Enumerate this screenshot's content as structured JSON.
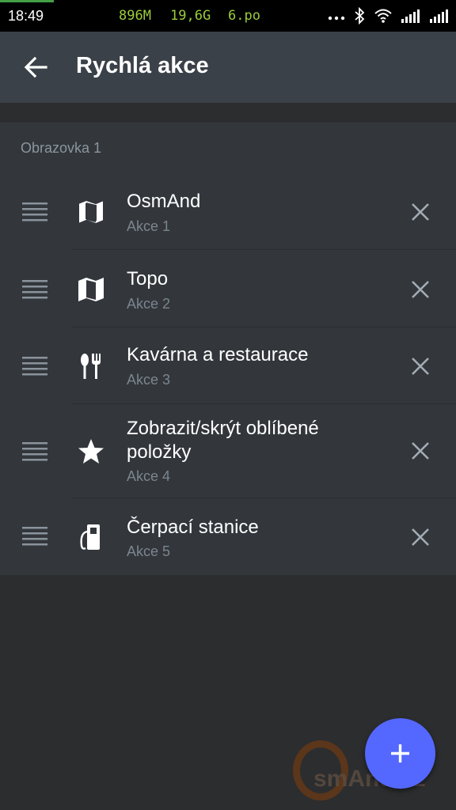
{
  "status_bar": {
    "time": "18:49",
    "ram": "896M",
    "storage": "19,6G",
    "day": "6.po",
    "icons": [
      "more-icon",
      "bluetooth-icon",
      "wifi-icon",
      "signal-icon",
      "signal-icon"
    ]
  },
  "app_bar": {
    "title": "Rychlá akce",
    "back_icon": "arrow-back-icon"
  },
  "section": {
    "title": "Obrazovka 1"
  },
  "actions": [
    {
      "label": "OsmAnd",
      "sub": "Akce 1",
      "icon": "map-icon"
    },
    {
      "label": "Topo",
      "sub": "Akce 2",
      "icon": "map-icon"
    },
    {
      "label": "Kavárna a restaurace",
      "sub": "Akce 3",
      "icon": "restaurant-icon"
    },
    {
      "label": "Zobrazit/skrýt oblíbené položky",
      "sub": "Akce 4",
      "icon": "star-icon"
    },
    {
      "label": "Čerpací stanice",
      "sub": "Akce 5",
      "icon": "fuel-icon"
    }
  ],
  "fab": {
    "icon": "plus-icon"
  },
  "watermark": "smAnd.cz",
  "colors": {
    "background": "#2c2d2f",
    "app_bar": "#3a4148",
    "card": "#33373c",
    "fab": "#5468ff",
    "secondary_text": "#7b858e"
  }
}
